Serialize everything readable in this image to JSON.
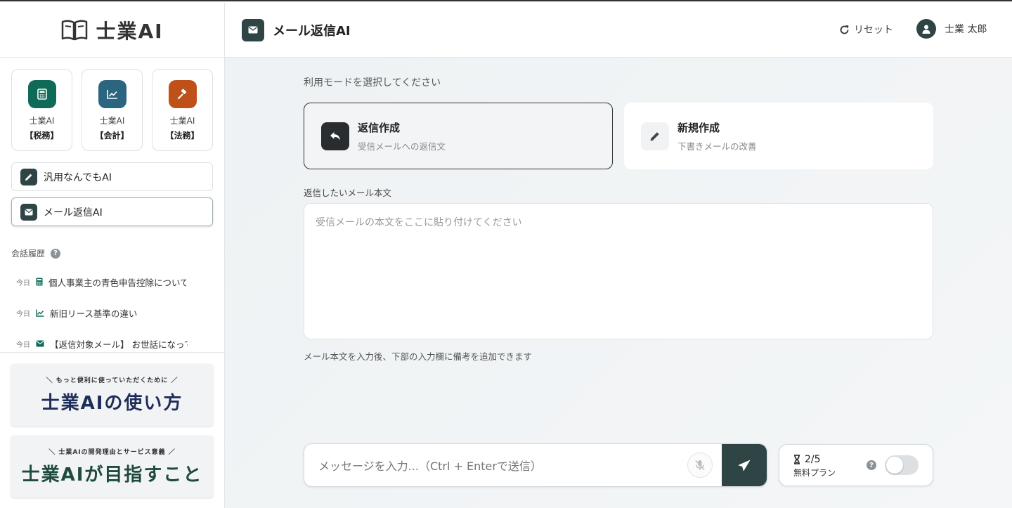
{
  "brand": {
    "logo_text": "士業AI"
  },
  "categories": [
    {
      "name": "士業AI",
      "sub": "【税務】",
      "color": "#0f6b57"
    },
    {
      "name": "士業AI",
      "sub": "【会計】",
      "color": "#2b6580"
    },
    {
      "name": "士業AI",
      "sub": "【法務】",
      "color": "#c0501a"
    }
  ],
  "nav": {
    "general": "汎用なんでもAI",
    "mail": "メール返信AI"
  },
  "history": {
    "title": "会話履歴",
    "help": "?",
    "items": [
      {
        "date": "今日",
        "icon": "calculator-icon",
        "text": "個人事業主の青色申告控除について"
      },
      {
        "date": "今日",
        "icon": "chart-icon",
        "text": "新旧リース基準の違い"
      },
      {
        "date": "今日",
        "icon": "mail-icon",
        "text": "【返信対象メール】 お世話になって"
      }
    ]
  },
  "banners": [
    {
      "sub": "＼ もっと便利に使っていただくために ／",
      "main": "士業AIの使い方"
    },
    {
      "sub": "＼ 士業AIの開発理由とサービス意義 ／",
      "main": "士業AIが目指すこと"
    }
  ],
  "header": {
    "title": "メール返信AI",
    "reset": "リセット",
    "user": "士業 太郎"
  },
  "main": {
    "mode_label": "利用モードを選択してください",
    "modes": [
      {
        "title": "返信作成",
        "desc": "受信メールへの返信文"
      },
      {
        "title": "新規作成",
        "desc": "下書きメールの改善"
      }
    ],
    "text_label": "返信したいメール本文",
    "textarea_placeholder": "受信メールの本文をここに貼り付けてください",
    "hint": "メール本文を入力後、下部の入力欄に備考を追加できます",
    "input_placeholder": "メッセージを入力...（Ctrl + Enterで送信）"
  },
  "plan": {
    "count": "2/5",
    "name": "無料プラン",
    "help": "?"
  }
}
